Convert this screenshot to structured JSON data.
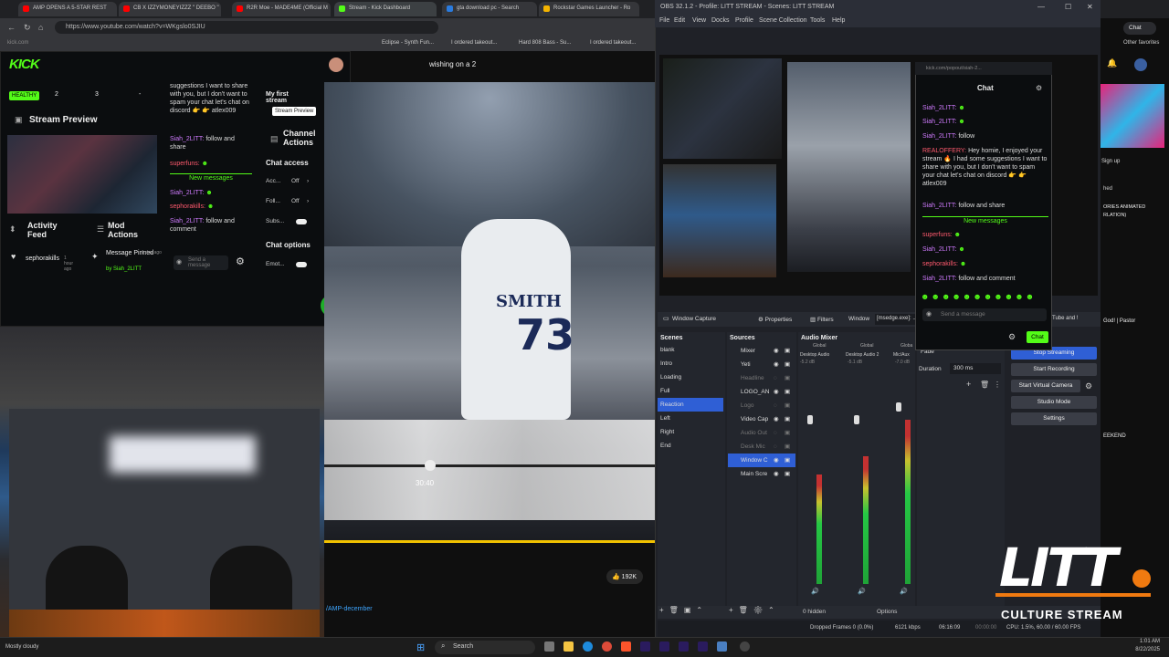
{
  "browser": {
    "tabs": [
      {
        "label": "AMP OPENS A 5-STAR REST",
        "color": "#ff0000"
      },
      {
        "label": "CB X IZZYMONEYIZZZ \" DEEBO \"",
        "color": "#ff0000"
      },
      {
        "label": "R2R Moe - MADE4ME (Official M",
        "color": "#ff0000"
      },
      {
        "label": "Stream - Kick Dashboard",
        "color": "#53fc18"
      },
      {
        "label": "gta download pc - Search",
        "color": "#2a7bde"
      },
      {
        "label": "Rockstar Games Launcher - Ro",
        "color": "#f4b400"
      }
    ],
    "url": "https://www.youtube.com/watch?v=WKgslo0SJIU",
    "bookmarks": [
      "Eclipse - Synth Fun...",
      "I ordered takeout...",
      "Hard 808 Bass - Su...",
      "I ordered takeout..."
    ],
    "other_favorites": "Other favorites",
    "popout_url": "kick.com/popout/siah-2..."
  },
  "kick": {
    "logo": "KICK",
    "health": "HEALTHY",
    "stats": [
      "2",
      "3",
      "-"
    ],
    "stream_preview_title": "Stream Preview",
    "activity_feed": "Activity Feed",
    "mod_actions": "Mod Actions",
    "activity_user": "sephorakills",
    "activity_time": "1 hour ago",
    "pinned_label": "Message Pinned",
    "pinned_time": "1 day ago",
    "pinned_by": "by Siah_2LITT",
    "send_placeholder": "Send a message",
    "chat": [
      {
        "user": "",
        "text": "suggestions I want to share with you, but I don't want to spam your chat let's chat on discord 👉 👉 atlex009"
      },
      {
        "user": "Siah_2LITT:",
        "text": "follow and share"
      },
      {
        "user": "superfuns:",
        "text": ""
      },
      {
        "user": "Siah_2LITT:",
        "text": ""
      },
      {
        "user": "sephorakills:",
        "text": ""
      },
      {
        "user": "Siah_2LITT:",
        "text": "follow and comment"
      }
    ],
    "new_messages": "New messages",
    "my_first_stream": "My first stream",
    "tooltip": "Stream Preview",
    "channel_actions": "Channel Actions",
    "chat_access": "Chat access",
    "access_rows": [
      {
        "label": "Acc...",
        "value": "Off"
      },
      {
        "label": "Foll...",
        "value": "Off"
      },
      {
        "label": "Subs...",
        "value": ""
      }
    ],
    "chat_options": "Chat options",
    "emote_label": "Emot..."
  },
  "youtube": {
    "video_title": "wishing on a 2",
    "jersey_name": "SMITH",
    "jersey_number": "73",
    "time_label": "30:40",
    "likes": "192K",
    "link": "/AMP-december"
  },
  "obs": {
    "title": "OBS 32.1.2 - Profile: LITT STREAM - Scenes: LITT STREAM",
    "menu": [
      "File",
      "Edit",
      "View",
      "Docks",
      "Profile",
      "Scene Collection",
      "Tools",
      "Help"
    ],
    "source_toolbar": {
      "name": "Window Capture",
      "properties": "Properties",
      "filters": "Filters",
      "window_label": "Window",
      "window_value": "[msedge.exe]: ...",
      "extra": "Tube and !"
    },
    "scenes_title": "Scenes",
    "scenes": [
      "blank",
      "Intro",
      "Loading",
      "Full",
      "Reaction",
      "Left",
      "Right",
      "End"
    ],
    "selected_scene": "Reaction",
    "sources_title": "Sources",
    "sources": [
      "Mixer",
      "Yeti",
      "Headline",
      "LOGO_AN",
      "Logo",
      "Video Cap",
      "Audio Out",
      "Desk Mic",
      "Window C",
      "Main Scre"
    ],
    "mixer_title": "Audio Mixer",
    "mixer_channels": [
      {
        "name": "Desktop Audio",
        "db": "-5.2 dB",
        "tag": "Global"
      },
      {
        "name": "Desktop Audio 2",
        "db": "-5.1 dB",
        "tag": "Global"
      },
      {
        "name": "Mic/Aux",
        "db": "-7.0 dB",
        "tag": "Globa"
      }
    ],
    "transition_label": "Fade",
    "duration_label": "Duration",
    "duration_value": "300 ms",
    "controls": [
      "Stop Streaming",
      "Start Recording",
      "Start Virtual Camera",
      "Studio Mode",
      "Settings"
    ],
    "hidden_count": "0 hidden",
    "options_label": "Options",
    "status": {
      "dropped": "Dropped Frames 0 (0.0%)",
      "kbps": "6121 kbps",
      "time": "06:16:09",
      "rec": "00:00:00",
      "cpu": "CPU: 1.5%, 60.00 / 60.00 FPS"
    }
  },
  "popchat": {
    "title": "Chat",
    "lines": [
      {
        "user": "Siah_2LITT:",
        "text": ""
      },
      {
        "user": "Siah_2LITT:",
        "text": ""
      },
      {
        "user": "Siah_2LITT:",
        "text": "follow"
      },
      {
        "user": "REALOFFERY:",
        "text": "Hey homie, I enjoyed your stream 🔥 I had some suggestions I want to share with you, but I don't want to spam your chat let's chat on discord 👉 👉 atlex009"
      },
      {
        "user": "Siah_2LITT:",
        "text": "follow and share"
      }
    ],
    "new_messages": "New messages",
    "lines2": [
      {
        "user": "superfuns:",
        "text": ""
      },
      {
        "user": "Siah_2LITT:",
        "text": ""
      },
      {
        "user": "sephorakills:",
        "text": ""
      },
      {
        "user": "Siah_2LITT:",
        "text": "follow and comment"
      }
    ],
    "placeholder": "Send a message",
    "chat_button": "Chat"
  },
  "rightpage": {
    "items": [
      "Sign up",
      "hed",
      "ORIES ANIMATED",
      "RLATION)",
      "God! | Pastor",
      "EEKEND"
    ],
    "chat_btn": "Chat"
  },
  "litt": {
    "logo": "LITT",
    "tagline": "CULTURE STREAM"
  },
  "taskbar": {
    "weather": "Mostly cloudy",
    "search": "Search",
    "time": "1:01 AM",
    "date": "8/22/2025"
  },
  "colors": {
    "kick_green": "#53fc18",
    "obs_selected": "#2f5fd5",
    "litt_orange": "#f07a10"
  }
}
